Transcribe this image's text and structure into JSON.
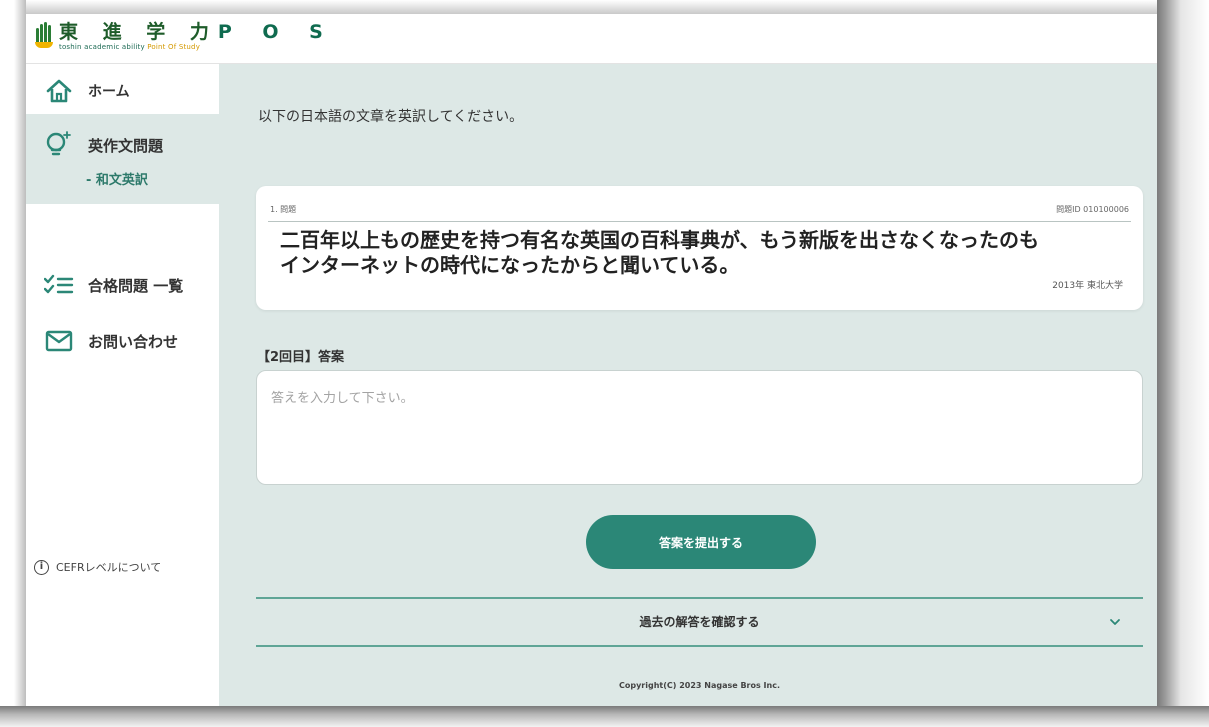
{
  "header": {
    "logo_kanji": "東 進 学 力",
    "logo_pos": "P O S",
    "logo_sub_before": "toshin academic ability ",
    "logo_sub_point": "Point",
    "logo_sub_after": " Of Study"
  },
  "sidebar": {
    "home": {
      "label": "ホーム",
      "icon": "home-icon"
    },
    "english_composition": {
      "label": "英作文問題",
      "icon": "lightbulb-icon",
      "sub_item": "- 和文英訳"
    },
    "passed_list": {
      "label": "合格問題 一覧",
      "icon": "checklist-icon"
    },
    "contact": {
      "label": "お問い合わせ",
      "icon": "mail-icon"
    },
    "cefr_link": {
      "label": "CEFRレベルについて",
      "icon": "info-icon",
      "icon_glyph": "i"
    }
  },
  "main": {
    "instruction": "以下の日本語の文章を英訳してください。",
    "question": {
      "number": "1. 問題",
      "id": "問題ID 010100006",
      "text_line1": "二百年以上もの歴史を持つ有名な英国の百科事典が、もう新版を出さなくなったのも",
      "text_line2": "インターネットの時代になったからと聞いている。",
      "source": "2013年 東北大学"
    },
    "answer": {
      "label": "【2回目】答案",
      "placeholder": "答えを入力して下さい。",
      "value": ""
    },
    "submit_label": "答案を提出する",
    "past_answers_label": "過去の解答を確認する",
    "copyright": "Copyright(C) 2023 Nagase Bros Inc."
  },
  "colors": {
    "accent": "#2b8777",
    "main_bg": "#dde8e6",
    "logo_green": "#2a7d35",
    "logo_yellow": "#f0b400",
    "divider": "#5fa596"
  }
}
